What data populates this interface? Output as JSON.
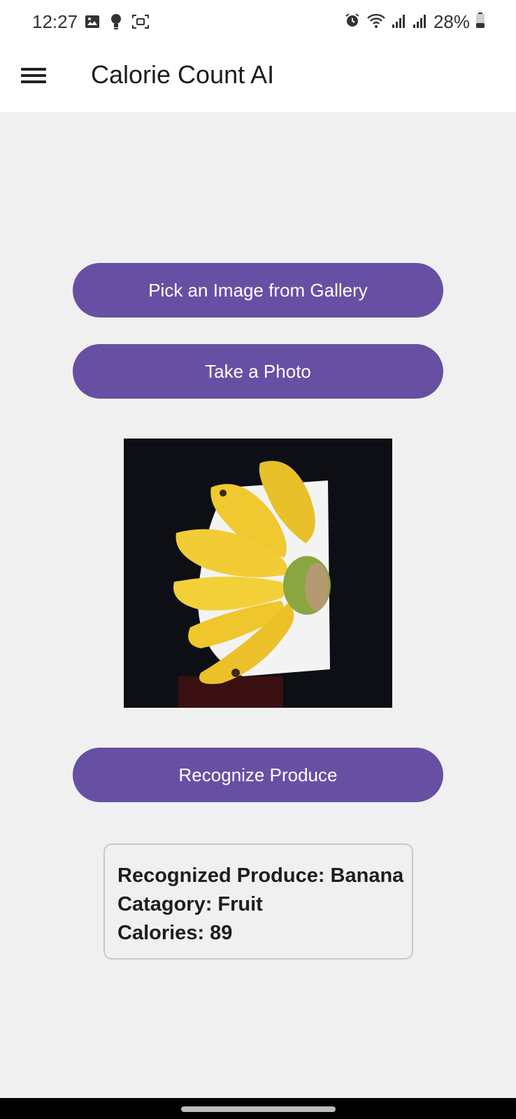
{
  "status_bar": {
    "time": "12:27",
    "battery": "28%",
    "left_icons": [
      "image-icon",
      "lightbulb-icon",
      "screen-capture-icon"
    ],
    "right_icons": [
      "alarm-icon",
      "wifi-icon",
      "signal-icon",
      "signal-icon",
      "battery-icon"
    ]
  },
  "app_bar": {
    "title": "Calorie Count AI",
    "menu_icon": "hamburger-menu-icon"
  },
  "actions": {
    "gallery_label": "Pick an Image from Gallery",
    "photo_label": "Take a Photo",
    "recognize_label": "Recognize Produce"
  },
  "result": {
    "produce": "Recognized Produce: Banana",
    "category": "Catagory: Fruit",
    "calories": "Calories: 89"
  },
  "colors": {
    "accent": "#6750a4",
    "background": "#f0f0f0",
    "app_bar": "#ffffff"
  }
}
